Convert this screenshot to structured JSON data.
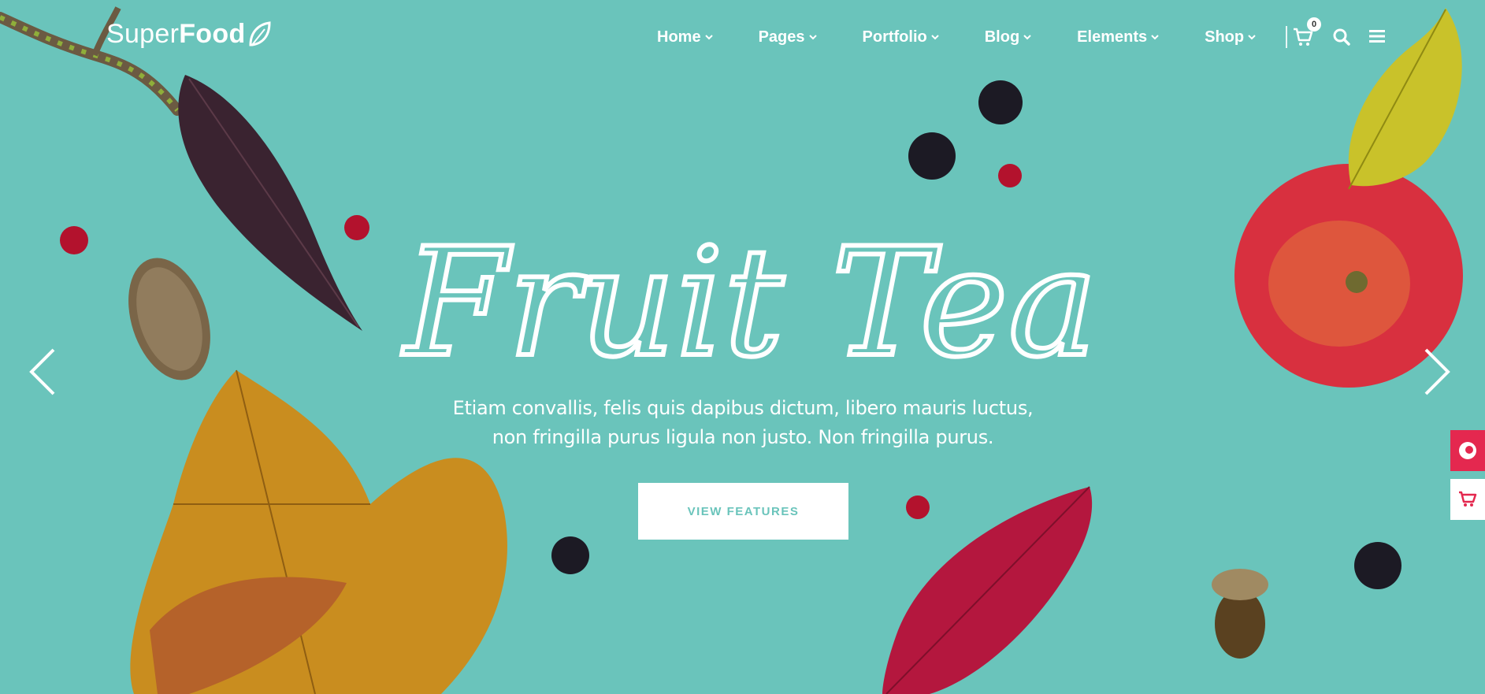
{
  "brand": {
    "part1": "Super",
    "part2": "Food",
    "icon": "leaf-icon"
  },
  "nav": {
    "items": [
      {
        "label": "Home"
      },
      {
        "label": "Pages"
      },
      {
        "label": "Portfolio"
      },
      {
        "label": "Blog"
      },
      {
        "label": "Elements"
      },
      {
        "label": "Shop"
      }
    ],
    "cart_count": "0",
    "icons": [
      "cart-icon",
      "search-icon",
      "menu-icon"
    ]
  },
  "hero": {
    "title": "Fruit Tea",
    "text_line1": "Etiam convallis, felis quis dapibus dictum, libero mauris luctus,",
    "text_line2": "non fringilla purus ligula non justo. Non fringilla purus.",
    "cta_label": "VIEW FEATURES"
  },
  "slider": {
    "prev_icon": "chevron-left-icon",
    "next_icon": "chevron-right-icon"
  },
  "side_widgets": [
    "support-icon",
    "cart-icon"
  ],
  "colors": {
    "background": "#6ac4bb",
    "accent": "#e4284f",
    "text": "#ffffff"
  }
}
